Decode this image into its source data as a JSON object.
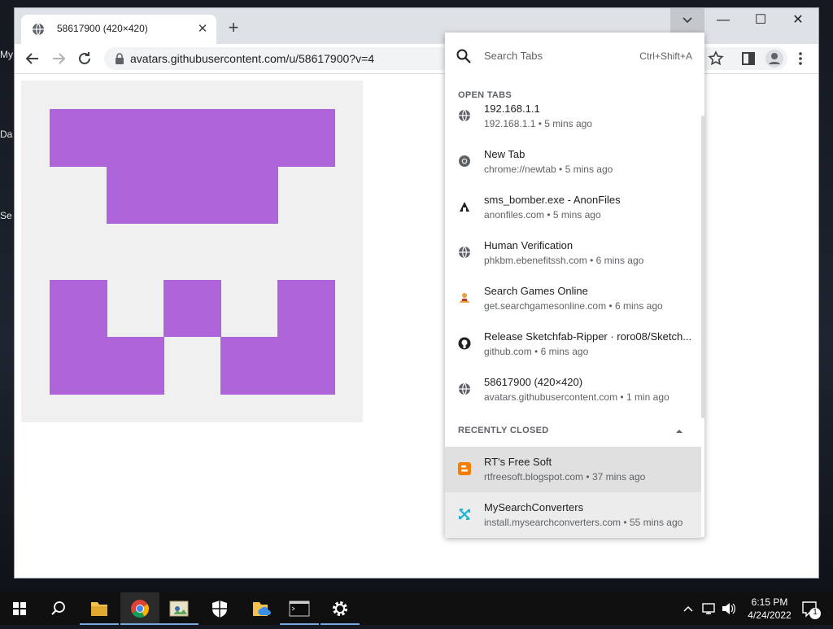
{
  "browser": {
    "tab": {
      "title": "58617900 (420×420)"
    },
    "window_controls": {
      "minimize": "—",
      "maximize": "☐",
      "close": "✕"
    },
    "toolbar": {
      "url": "avatars.githubusercontent.com/u/58617900?v=4"
    }
  },
  "tab_search": {
    "placeholder": "Search Tabs",
    "shortcut": "Ctrl+Shift+A",
    "open_tabs_label": "OPEN TABS",
    "recently_closed_label": "RECENTLY CLOSED",
    "open_tabs": [
      {
        "title": "192.168.1.1",
        "url": "192.168.1.1",
        "time": "5 mins ago",
        "icon": "globe-icon"
      },
      {
        "title": "New Tab",
        "url": "chrome://newtab",
        "time": "5 mins ago",
        "icon": "chrome-icon"
      },
      {
        "title": "sms_bomber.exe - AnonFiles",
        "url": "anonfiles.com",
        "time": "5 mins ago",
        "icon": "anonfiles-icon"
      },
      {
        "title": "Human Verification",
        "url": "phkbm.ebenefitssh.com",
        "time": "6 mins ago",
        "icon": "globe-icon"
      },
      {
        "title": "Search Games Online",
        "url": "get.searchgamesonline.com",
        "time": "6 mins ago",
        "icon": "games-icon"
      },
      {
        "title": "Release Sketchfab-Ripper · roro08/Sketch...",
        "url": "github.com",
        "time": "6 mins ago",
        "icon": "github-icon"
      },
      {
        "title": "58617900 (420×420)",
        "url": "avatars.githubusercontent.com",
        "time": "1 min ago",
        "icon": "globe-icon"
      }
    ],
    "recently_closed": [
      {
        "title": "RT's Free Soft",
        "url": "rtfreesoft.blogspot.com",
        "time": "37 mins ago",
        "icon": "blogger-icon"
      },
      {
        "title": "MySearchConverters",
        "url": "install.mysearchconverters.com",
        "time": "55 mins ago",
        "icon": "converter-icon"
      }
    ]
  },
  "desktop": {
    "icon_labels": [
      "My",
      "Da",
      "Se"
    ]
  },
  "taskbar": {
    "time": "6:15 PM",
    "date": "4/24/2022",
    "notification_count": "1",
    "apps": [
      "start-icon",
      "search-icon",
      "file-explorer-icon",
      "chrome-icon",
      "image-viewer-icon",
      "security-icon",
      "onedrive-folder-icon",
      "terminal-icon",
      "settings-icon"
    ]
  },
  "colors": {
    "avatar_purple": "#ad65d9",
    "avatar_bg": "#f0f0f0",
    "accent": "#1a73e8"
  }
}
